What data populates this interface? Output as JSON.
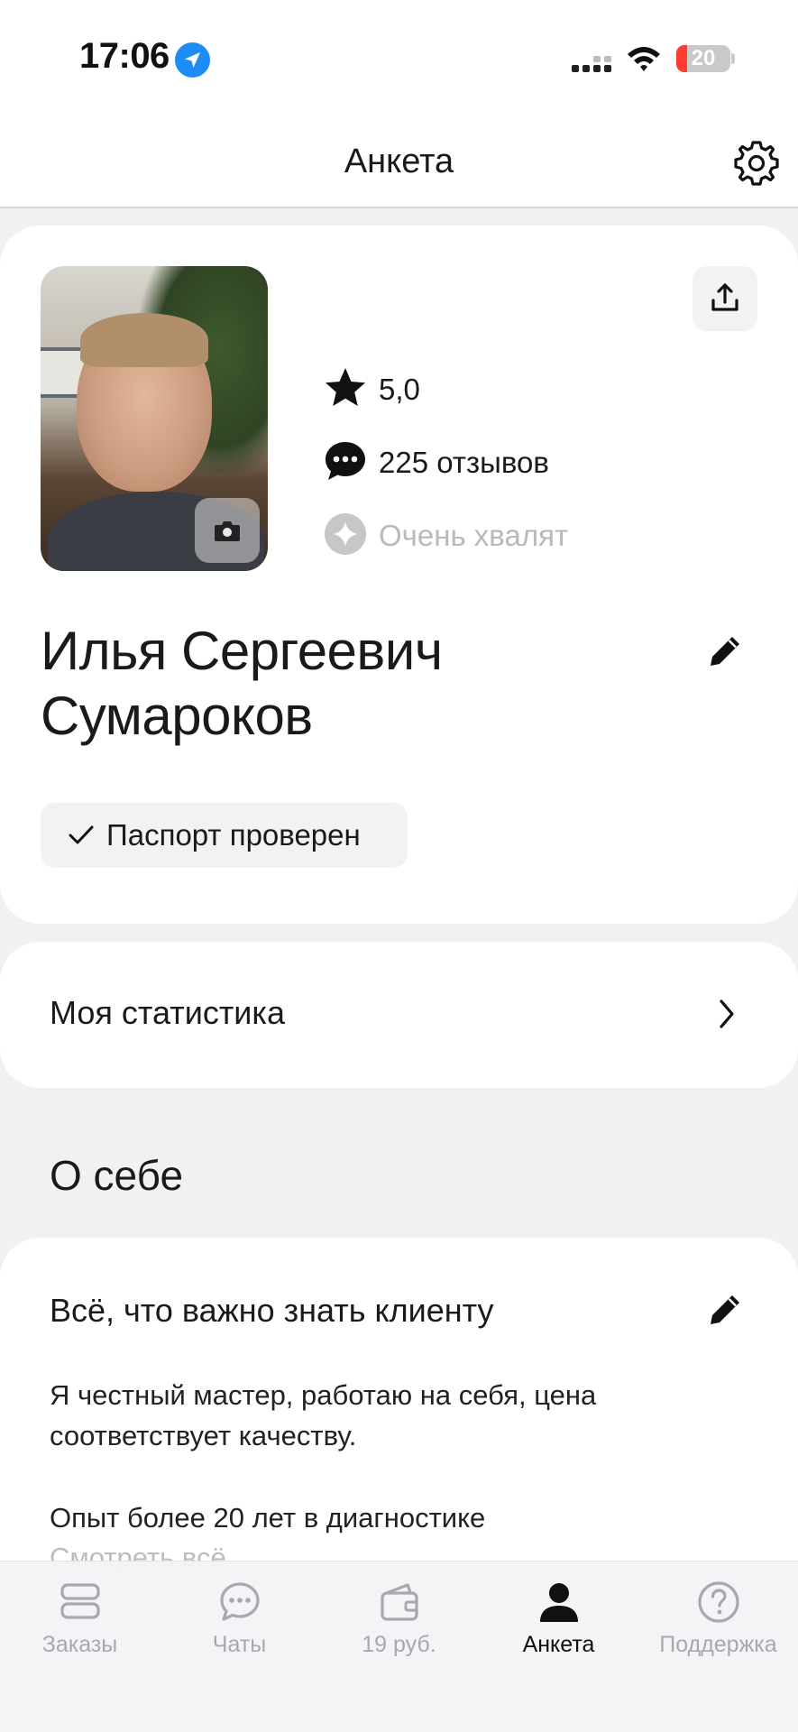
{
  "status_bar": {
    "time": "17:06",
    "battery": "20",
    "icons": [
      "location-arrow-icon",
      "cellular-signal-icon",
      "wifi-icon",
      "battery-icon"
    ]
  },
  "header": {
    "title": "Анкета",
    "settings_icon": "gear-icon"
  },
  "profile": {
    "rating": "5,0",
    "reviews": "225 отзывов",
    "badge": "Очень хвалят",
    "name_line1": "Илья Сергеевич",
    "name_line2": "Сумароков",
    "verified": "Паспорт проверен"
  },
  "stats": {
    "label": "Моя статистика"
  },
  "about": {
    "section_title": "О себе",
    "heading": "Всё, что важно знать клиенту",
    "paragraph1": "Я честный мастер, работаю на себя, цена соответствует качеству.",
    "paragraph2": "Опыт более 20 лет в диагностике",
    "more_link": "Смотреть всё"
  },
  "tabs": [
    {
      "label": "Заказы",
      "icon": "orders-icon",
      "active": false
    },
    {
      "label": "Чаты",
      "icon": "chat-icon",
      "active": false
    },
    {
      "label": "19 руб.",
      "icon": "wallet-icon",
      "active": false
    },
    {
      "label": "Анкета",
      "icon": "profile-icon",
      "active": true
    },
    {
      "label": "Поддержка",
      "icon": "help-icon",
      "active": false
    }
  ],
  "colors": {
    "accent_blue": "#1e8cf5",
    "battery_low": "#ff3b30",
    "muted_text": "#b9b9b9",
    "background": "#f1f1f1"
  }
}
